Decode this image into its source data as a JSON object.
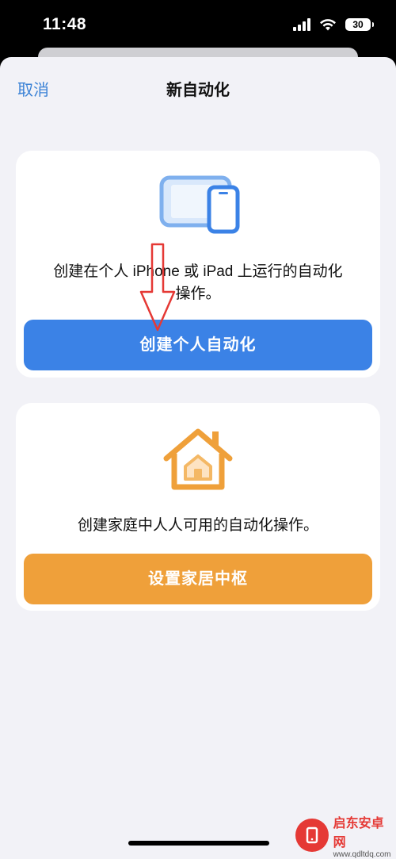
{
  "status": {
    "time": "11:48",
    "battery": "30"
  },
  "nav": {
    "cancel": "取消",
    "title": "新自动化"
  },
  "personal": {
    "description_line1": "创建在个人 iPhone 或 iPad 上运行的自动化",
    "description_line2": "操作。",
    "button": "创建个人自动化"
  },
  "home": {
    "description": "创建家庭中人人可用的自动化操作。",
    "button": "设置家居中枢"
  },
  "watermark": {
    "name": "启东安卓网",
    "url": "www.qdltdq.com"
  },
  "colors": {
    "accent_blue": "#3b82e6",
    "accent_orange": "#efa03a",
    "link_blue": "#3b82d6",
    "background": "#f2f2f7",
    "annotation_red": "#e53935"
  },
  "icons": [
    "cellular-signal-icon",
    "wifi-icon",
    "battery-icon",
    "ipad-iphone-icon",
    "home-icon",
    "red-arrow-annotation"
  ]
}
